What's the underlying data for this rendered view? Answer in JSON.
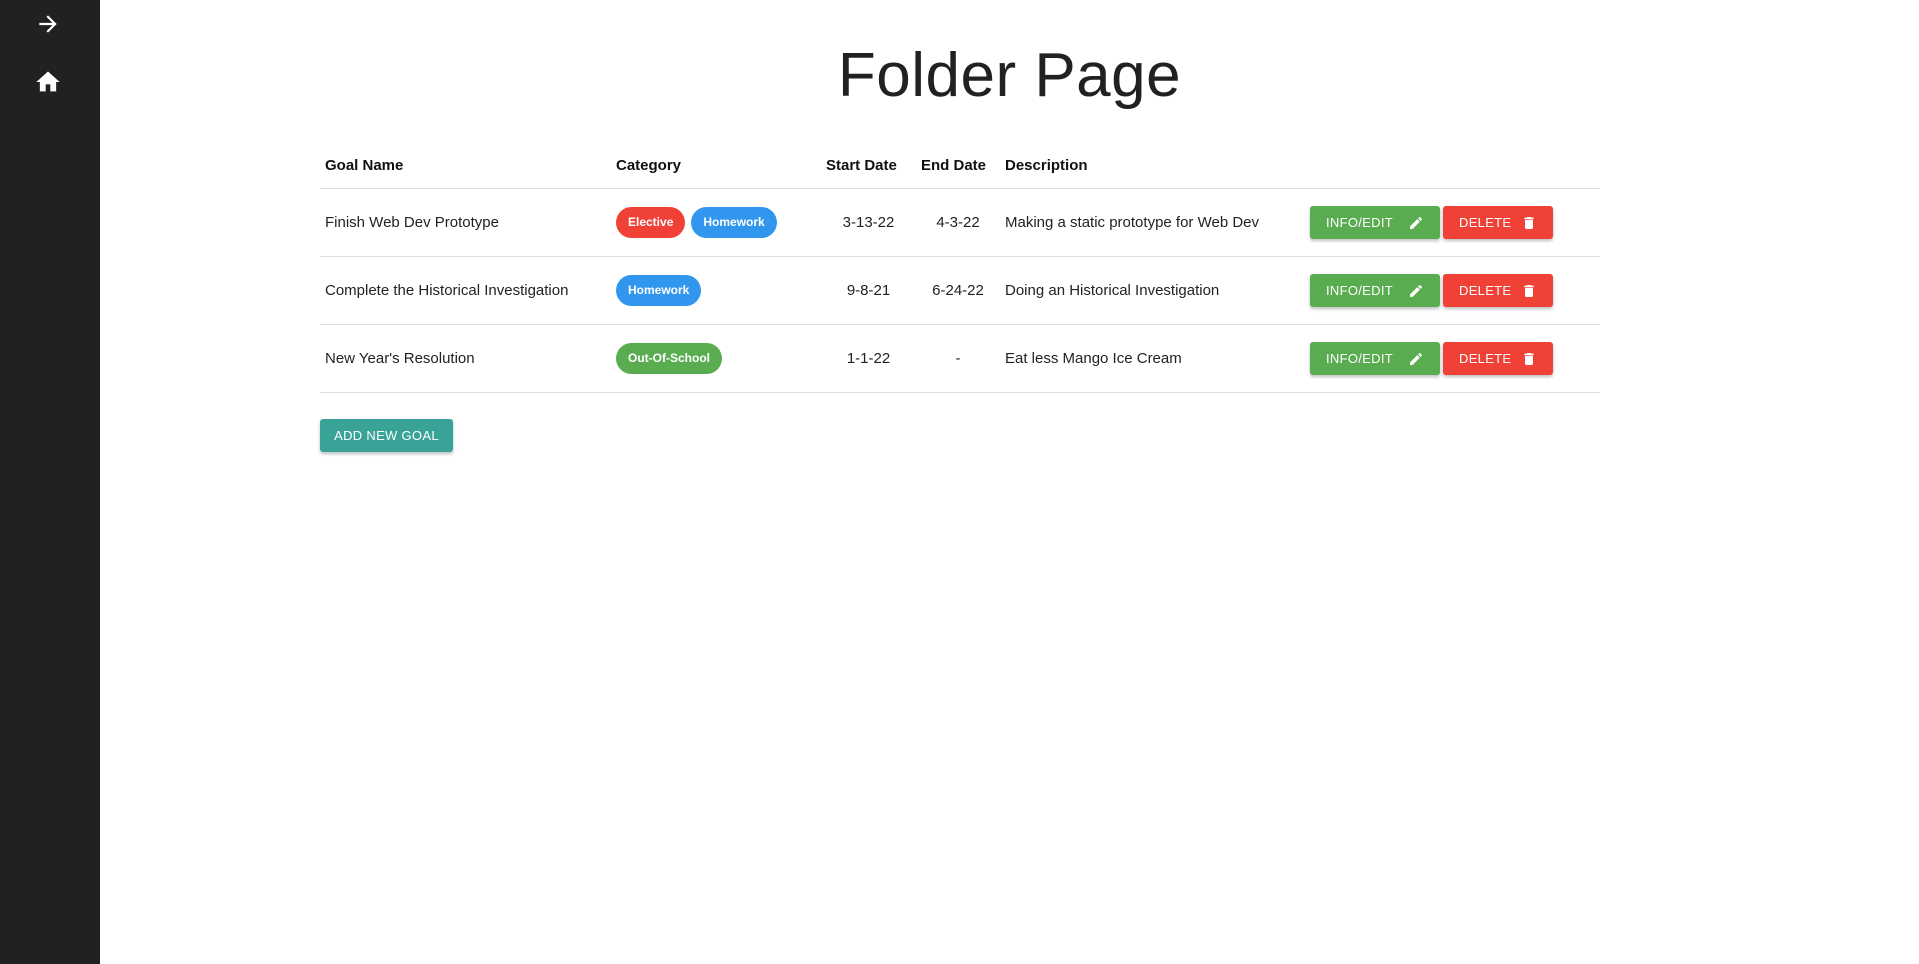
{
  "colors": {
    "sidebar": "#212121",
    "edit_green": "#5aac50",
    "delete_red": "#f04137",
    "add_teal": "#3aa397",
    "chip_red": "#f04137",
    "chip_blue": "#3196ee",
    "chip_green": "#5aac50"
  },
  "sidebar": {
    "items": [
      {
        "icon": "arrow-right-icon"
      },
      {
        "icon": "home-icon"
      }
    ]
  },
  "page": {
    "title": "Folder Page"
  },
  "table": {
    "headers": {
      "name": "Goal Name",
      "category": "Category",
      "start": "Start Date",
      "end": "End Date",
      "description": "Description"
    },
    "rows": [
      {
        "name": "Finish Web Dev Prototype",
        "categories": [
          {
            "label": "Elective",
            "color": "#f04137"
          },
          {
            "label": "Homework",
            "color": "#3196ee"
          }
        ],
        "start": "3-13-22",
        "end": "4-3-22",
        "description": "Making a static prototype for Web Dev",
        "edit_label": "INFO/EDIT",
        "delete_label": "DELETE"
      },
      {
        "name": "Complete the Historical Investigation",
        "categories": [
          {
            "label": "Homework",
            "color": "#3196ee"
          }
        ],
        "start": "9-8-21",
        "end": "6-24-22",
        "description": "Doing an Historical Investigation",
        "edit_label": "INFO/EDIT",
        "delete_label": "DELETE"
      },
      {
        "name": "New Year's Resolution",
        "categories": [
          {
            "label": "Out-Of-School",
            "color": "#5aac50"
          }
        ],
        "start": "1-1-22",
        "end": "-",
        "description": "Eat less Mango Ice Cream",
        "edit_label": "INFO/EDIT",
        "delete_label": "DELETE"
      }
    ]
  },
  "actions": {
    "add_label": "ADD NEW GOAL"
  }
}
